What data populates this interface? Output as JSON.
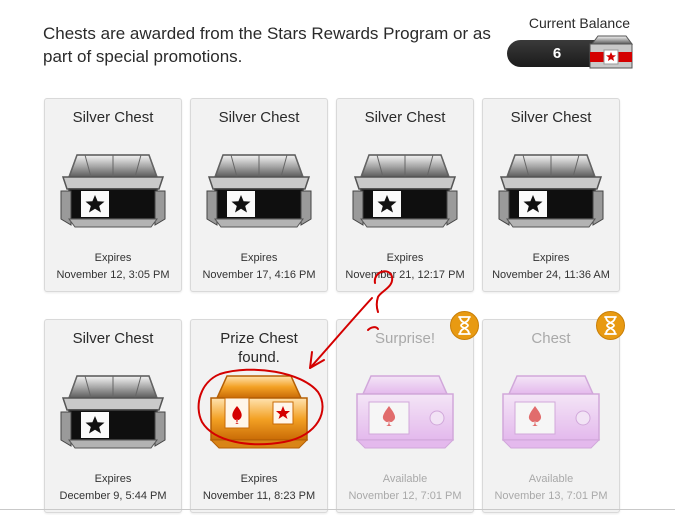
{
  "intro_text": "Chests are awarded from the Stars Rewards Program or as part of special promotions.",
  "balance": {
    "label": "Current Balance",
    "value": "6"
  },
  "colors": {
    "accent_red": "#d40000",
    "timer_orange": "#e89a12",
    "gold": "#f3a124",
    "pink": "#e3a9ef"
  },
  "cards": [
    {
      "title": "Silver Chest",
      "status_label": "Expires",
      "status_date": "November 12, 3:05 PM",
      "icon": "silver-chest-icon"
    },
    {
      "title": "Silver Chest",
      "status_label": "Expires",
      "status_date": "November 17, 4:16 PM",
      "icon": "silver-chest-icon"
    },
    {
      "title": "Silver Chest",
      "status_label": "Expires",
      "status_date": "November 21, 12:17 PM",
      "icon": "silver-chest-icon"
    },
    {
      "title": "Silver Chest",
      "status_label": "Expires",
      "status_date": "November 24, 11:36 AM",
      "icon": "silver-chest-icon"
    },
    {
      "title": "Silver Chest",
      "status_label": "Expires",
      "status_date": "December 9, 5:44 PM",
      "icon": "silver-chest-icon"
    },
    {
      "title": "Prize Chest found.",
      "status_label": "Expires",
      "status_date": "November 11, 8:23 PM",
      "icon": "gold-prize-chest-icon"
    },
    {
      "title": "Surprise!",
      "status_label": "Available",
      "status_date": "November 12, 7:01 PM",
      "icon": "pink-chest-icon",
      "timer": "hourglass-icon"
    },
    {
      "title": "Chest",
      "status_label": "Available",
      "status_date": "November 13, 7:01 PM",
      "icon": "pink-chest-icon",
      "timer": "hourglass-icon"
    }
  ]
}
